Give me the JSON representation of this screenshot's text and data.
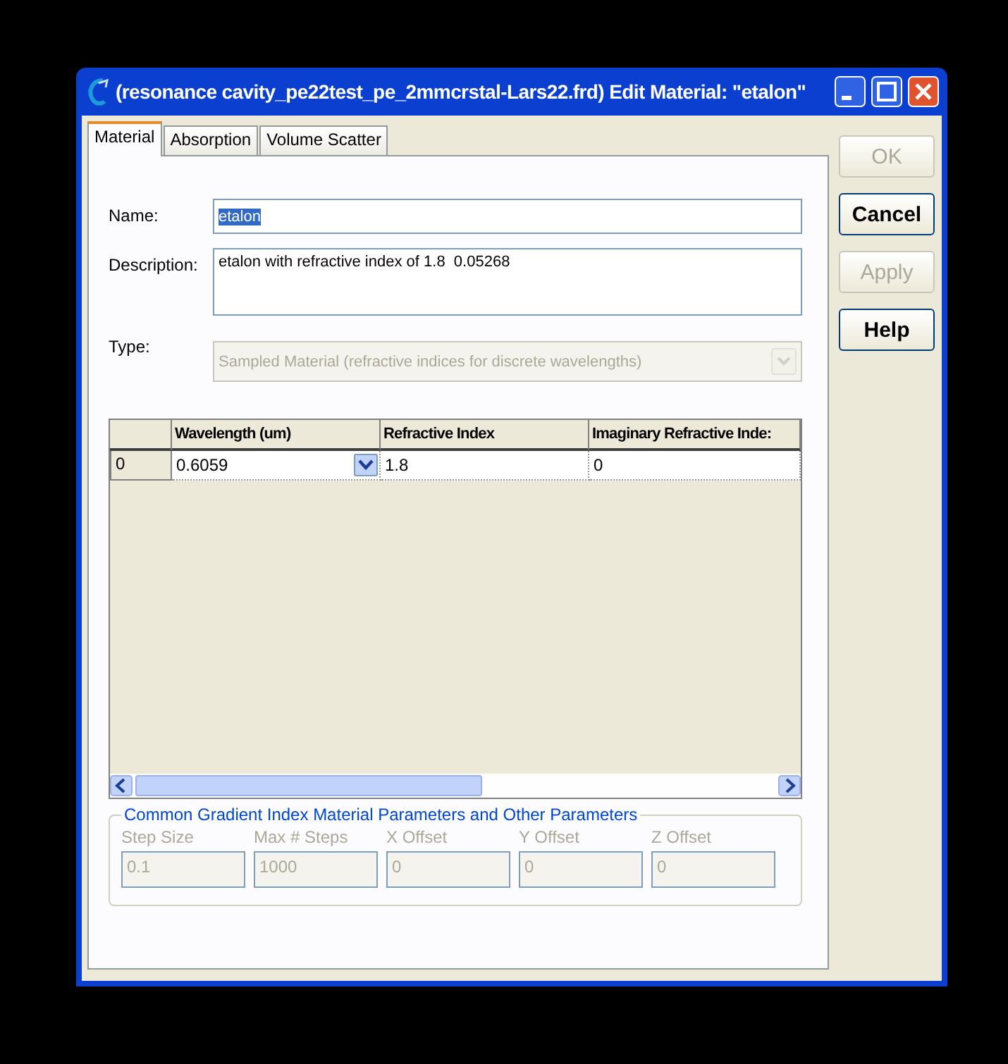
{
  "window": {
    "title": "(resonance cavity_pe22test_pe_2mmcrstal-Lars22.frd) Edit Material: \"etalon\""
  },
  "tabs": [
    {
      "label": "Material",
      "selected": true
    },
    {
      "label": "Absorption",
      "selected": false
    },
    {
      "label": "Volume Scatter",
      "selected": false
    }
  ],
  "fields": [
    {
      "kind": "text",
      "label": "Name:",
      "value": "etalon",
      "text_selected": true,
      "disabled": false
    },
    {
      "kind": "multiline",
      "label": "Description:",
      "value": "etalon with refractive index of 1.8  0.05268",
      "text_selected": false,
      "disabled": false
    },
    {
      "kind": "dropdown",
      "label": "Type:",
      "value": "Sampled Material (refractive indices for discrete wavelengths)",
      "text_selected": false,
      "disabled": true
    }
  ],
  "table": {
    "columns": [
      "Wavelength (um)",
      "Refractive Index",
      "Imaginary Refractive Inde:"
    ],
    "rows": [
      {
        "index": "0",
        "cells": [
          {
            "kind": "dropdown",
            "value": "0.6059"
          },
          {
            "kind": "text",
            "value": "1.8"
          },
          {
            "kind": "text",
            "value": "0"
          }
        ]
      }
    ]
  },
  "parameters": {
    "title": "Common Gradient Index Material Parameters and Other Parameters",
    "disabled": true,
    "items": [
      {
        "label": "Step Size",
        "value": "0.1"
      },
      {
        "label": "Max # Steps",
        "value": "1000"
      },
      {
        "label": "X Offset",
        "value": "0"
      },
      {
        "label": "Y Offset",
        "value": "0"
      },
      {
        "label": "Z Offset",
        "value": "0"
      }
    ]
  },
  "buttons": [
    {
      "label": "OK",
      "disabled": true
    },
    {
      "label": "Cancel",
      "disabled": false
    },
    {
      "label": "Apply",
      "disabled": true
    },
    {
      "label": "Help",
      "disabled": false
    }
  ]
}
